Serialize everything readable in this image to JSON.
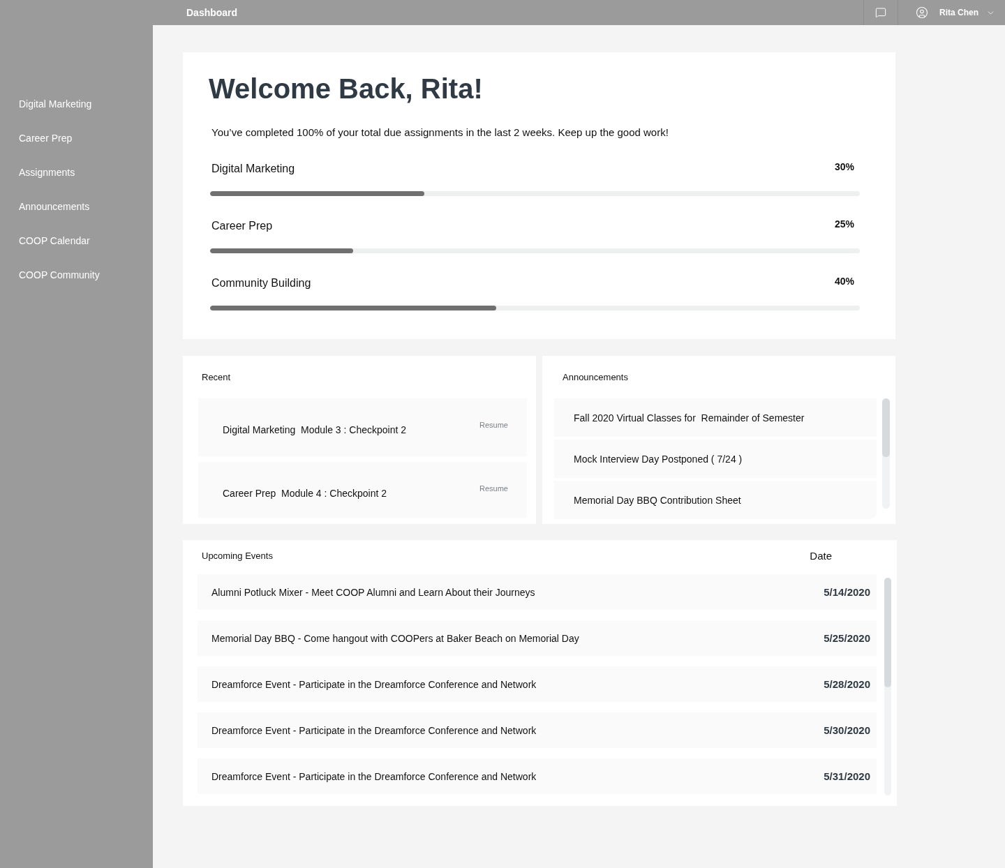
{
  "header": {
    "title": "Dashboard",
    "user": {
      "name": "Rita Chen"
    }
  },
  "sidebar": {
    "items": [
      {
        "label": "Digital Marketing"
      },
      {
        "label": "Career Prep"
      },
      {
        "label": "Assignments"
      },
      {
        "label": "Announcements"
      },
      {
        "label": "COOP Calendar"
      },
      {
        "label": "COOP Community"
      }
    ]
  },
  "welcome": {
    "title": "Welcome Back, Rita!",
    "message": "You’ve completed 100% of your total due assignments in the last 2 weeks. Keep up the good work!",
    "progress": [
      {
        "label": "Digital Marketing",
        "reading": "30%",
        "level": 0.33
      },
      {
        "label": "Career Prep",
        "reading": "25%",
        "level": 0.22
      },
      {
        "label": "Community Building",
        "reading": "40%",
        "level": 0.44
      }
    ]
  },
  "recent": {
    "title": "Recent",
    "items": [
      {
        "title": "Digital Marketing  Module 3 : Checkpoint 2",
        "action": "Resume"
      },
      {
        "title": "Career Prep  Module 4 : Checkpoint 2",
        "action": "Resume"
      }
    ]
  },
  "announcements": {
    "title": "Announcements",
    "items": [
      {
        "title": "Fall 2020 Virtual Classes for  Remainder of Semester"
      },
      {
        "title": "Mock Interview Day Postponed ( 7/24 )"
      },
      {
        "title": "Memorial Day BBQ Contribution Sheet"
      }
    ]
  },
  "events": {
    "title": "Upcoming Events",
    "date_header": "Date",
    "rows": [
      {
        "title": "Alumni Potluck Mixer - Meet COOP Alumni and Learn About their Journeys",
        "date": "5/14/2020"
      },
      {
        "title": "Memorial Day BBQ - Come hangout with COOPers at Baker Beach on Memorial Day",
        "date": "5/25/2020"
      },
      {
        "title": "Dreamforce Event - Participate in the Dreamforce Conference and Network",
        "date": "5/28/2020"
      },
      {
        "title": "Dreamforce Event - Participate in the Dreamforce Conference and Network",
        "date": "5/30/2020"
      },
      {
        "title": "Dreamforce Event - Participate in the Dreamforce Conference and Network",
        "date": "5/31/2020"
      }
    ]
  }
}
